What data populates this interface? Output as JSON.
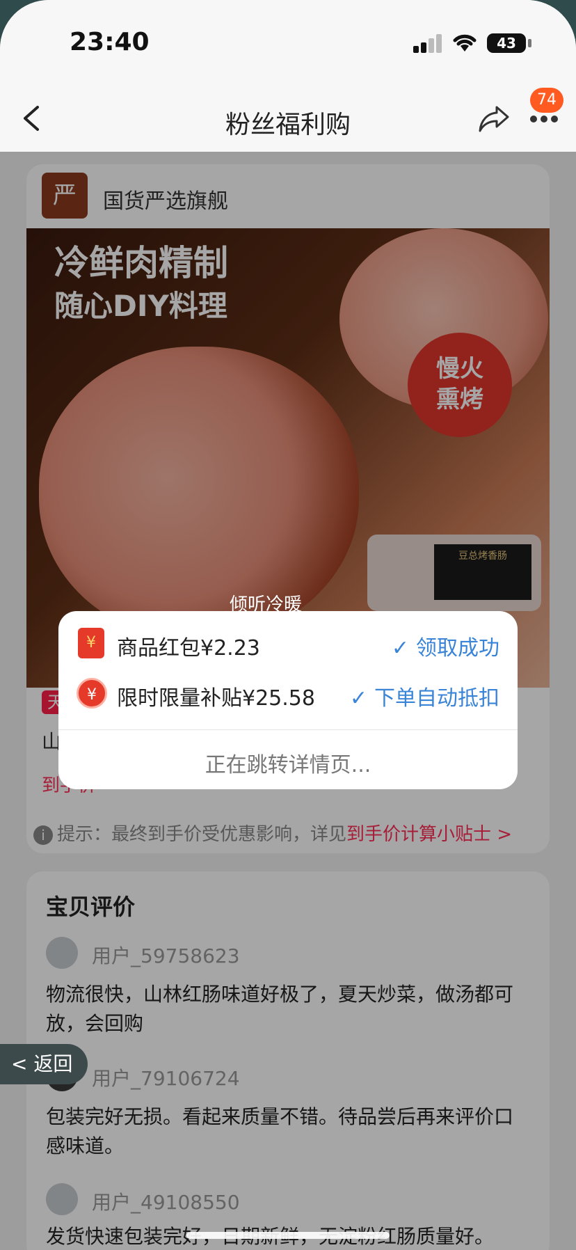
{
  "status_bar": {
    "time": "23:40",
    "battery": "43"
  },
  "nav": {
    "title": "粉丝福利购",
    "badge_count": "74"
  },
  "shop": {
    "logo_text": "严",
    "name": "国货严选旗舰"
  },
  "banner": {
    "headline1": "冷鲜肉精制",
    "headline2": "随心DIY料理",
    "fire_badge_line1": "慢火",
    "fire_badge_line2": "熏烤",
    "package_label": "豆总烤香肠"
  },
  "product": {
    "tag": "天",
    "title_first_char": "山",
    "price_label": "到手价",
    "tip_prefix": "提示：最终到手价受优惠影响，详见",
    "tip_link": "到手价计算小贴士 >"
  },
  "reviews": {
    "title": "宝贝评价",
    "items": [
      {
        "user": "用户_59758623",
        "text": "物流很快，山林红肠味道好极了，夏天炒菜，做汤都可放，会回购"
      },
      {
        "user": "用户_79106724",
        "text": "包装完好无损。看起来质量不错。待品尝后再来评价口感味道。"
      },
      {
        "user": "用户_49108550",
        "text": "发货快速包装完好，日期新鲜，无淀粉红肠质量好。"
      }
    ]
  },
  "floating": {
    "back_label": "返回"
  },
  "toast": {
    "user": "倾听冷暖"
  },
  "modal": {
    "rows": [
      {
        "label": "商品红包¥2.23",
        "status": "领取成功"
      },
      {
        "label": "限时限量补贴¥25.58",
        "status": "下单自动抵扣"
      }
    ],
    "footer": "正在跳转详情页..."
  }
}
